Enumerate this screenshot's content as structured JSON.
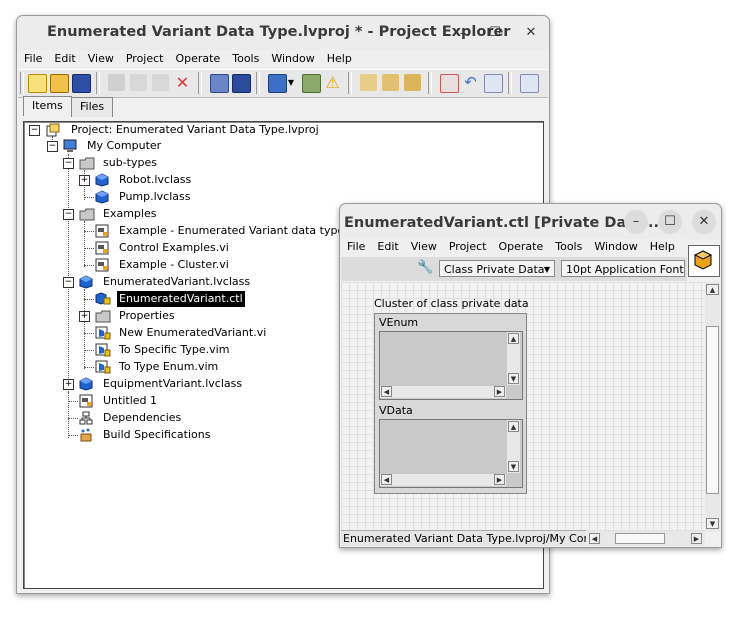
{
  "project_window": {
    "title": "Enumerated Variant Data Type.lvproj * - Project Explorer",
    "menu": [
      "File",
      "Edit",
      "View",
      "Project",
      "Operate",
      "Tools",
      "Window",
      "Help"
    ],
    "tabs": [
      "Items",
      "Files"
    ],
    "tree": [
      {
        "label": "Project: Enumerated Variant Data Type.lvproj",
        "icon": "project-icon"
      },
      {
        "label": "My Computer",
        "icon": "computer-icon"
      },
      {
        "label": "sub-types",
        "icon": "folder-icon"
      },
      {
        "label": "Robot.lvclass",
        "icon": "class-cube-icon"
      },
      {
        "label": "Pump.lvclass",
        "icon": "class-cube-icon"
      },
      {
        "label": "Examples",
        "icon": "folder-icon"
      },
      {
        "label": "Example - Enumerated Variant data type.vi",
        "icon": "vi-icon"
      },
      {
        "label": "Control Examples.vi",
        "icon": "vi-icon"
      },
      {
        "label": "Example - Cluster.vi",
        "icon": "vi-icon"
      },
      {
        "label": "EnumeratedVariant.lvclass",
        "icon": "class-cube-icon"
      },
      {
        "label": "EnumeratedVariant.ctl",
        "icon": "class-control-icon"
      },
      {
        "label": "Properties",
        "icon": "folder-icon"
      },
      {
        "label": "New EnumeratedVariant.vi",
        "icon": "method-vi-icon"
      },
      {
        "label": "To Specific Type.vim",
        "icon": "method-vi-icon"
      },
      {
        "label": "To Type Enum.vim",
        "icon": "method-vi-icon"
      },
      {
        "label": "EquipmentVariant.lvclass",
        "icon": "class-cube-icon"
      },
      {
        "label": "Untitled 1",
        "icon": "vi-icon"
      },
      {
        "label": "Dependencies",
        "icon": "dependencies-icon"
      },
      {
        "label": "Build Specifications",
        "icon": "build-icon"
      }
    ]
  },
  "control_window": {
    "title": "EnumeratedVariant.ctl [Private Data ...",
    "menu": [
      "File",
      "Edit",
      "View",
      "Project",
      "Operate",
      "Tools",
      "Window",
      "Help"
    ],
    "class_private_data_ring": "Class Private Data",
    "font_ring": "10pt Application Font",
    "cluster_label": "Cluster of class private data",
    "venum_label": "VEnum",
    "vdata_label": "VData",
    "status_path": "Enumerated Variant Data Type.lvproj/My Computer"
  },
  "icons": {
    "minimize": "minimize-icon",
    "maximize": "maximize-icon",
    "close": "close-icon"
  },
  "colors": {
    "selection_bg": "#000000",
    "class_cube_blue": "#1f63d1",
    "folder_gray": "#b8b8b8"
  }
}
